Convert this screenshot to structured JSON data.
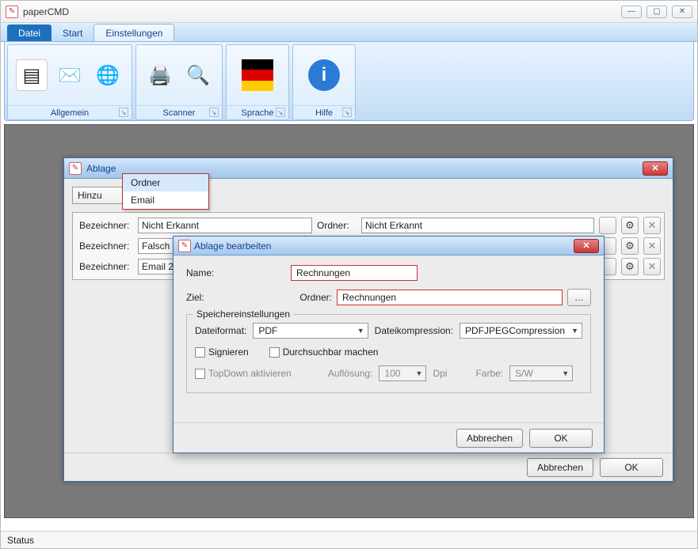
{
  "window": {
    "title": "paperCMD"
  },
  "tabs": {
    "primary": "Datei",
    "start": "Start",
    "settings": "Einstellungen"
  },
  "ribbon": {
    "general": "Allgemein",
    "scanner": "Scanner",
    "language": "Sprache",
    "help": "Hilfe"
  },
  "innerWindow": {
    "title": "Ablage",
    "addBtn": "Hinzu",
    "colLabel": "Bezeichner:",
    "colFolder": "Ordner:",
    "rows": [
      {
        "name": "Nicht Erkannt",
        "folder": "Nicht Erkannt"
      },
      {
        "name": "Falsch",
        "folder": ""
      },
      {
        "name": "Email 2",
        "folder": ""
      }
    ],
    "cancel": "Abbrechen",
    "ok": "OK"
  },
  "ctxMenu": {
    "item1": "Ordner",
    "item2": "Email"
  },
  "dialog": {
    "title": "Ablage bearbeiten",
    "nameLabel": "Name:",
    "nameValue": "Rechnungen",
    "zielLabel": "Ziel:",
    "zielFolderLabel": "Ordner:",
    "zielFolderValue": "Rechnungen",
    "storageLegend": "Speichereinstellungen",
    "fileFormatLabel": "Dateiformat:",
    "fileFormatValue": "PDF",
    "compressionLabel": "Dateikompression:",
    "compressionValue": "PDFJPEGCompression",
    "signLabel": "Signieren",
    "searchableLabel": "Durchsuchbar machen",
    "topdownLabel": "TopDown aktivieren",
    "resolutionLabel": "Auflösung:",
    "resolutionValue": "100",
    "dpi": "Dpi",
    "colorLabel": "Farbe:",
    "colorValue": "S/W",
    "cancel": "Abbrechen",
    "ok": "OK"
  },
  "statusbar": "Status"
}
